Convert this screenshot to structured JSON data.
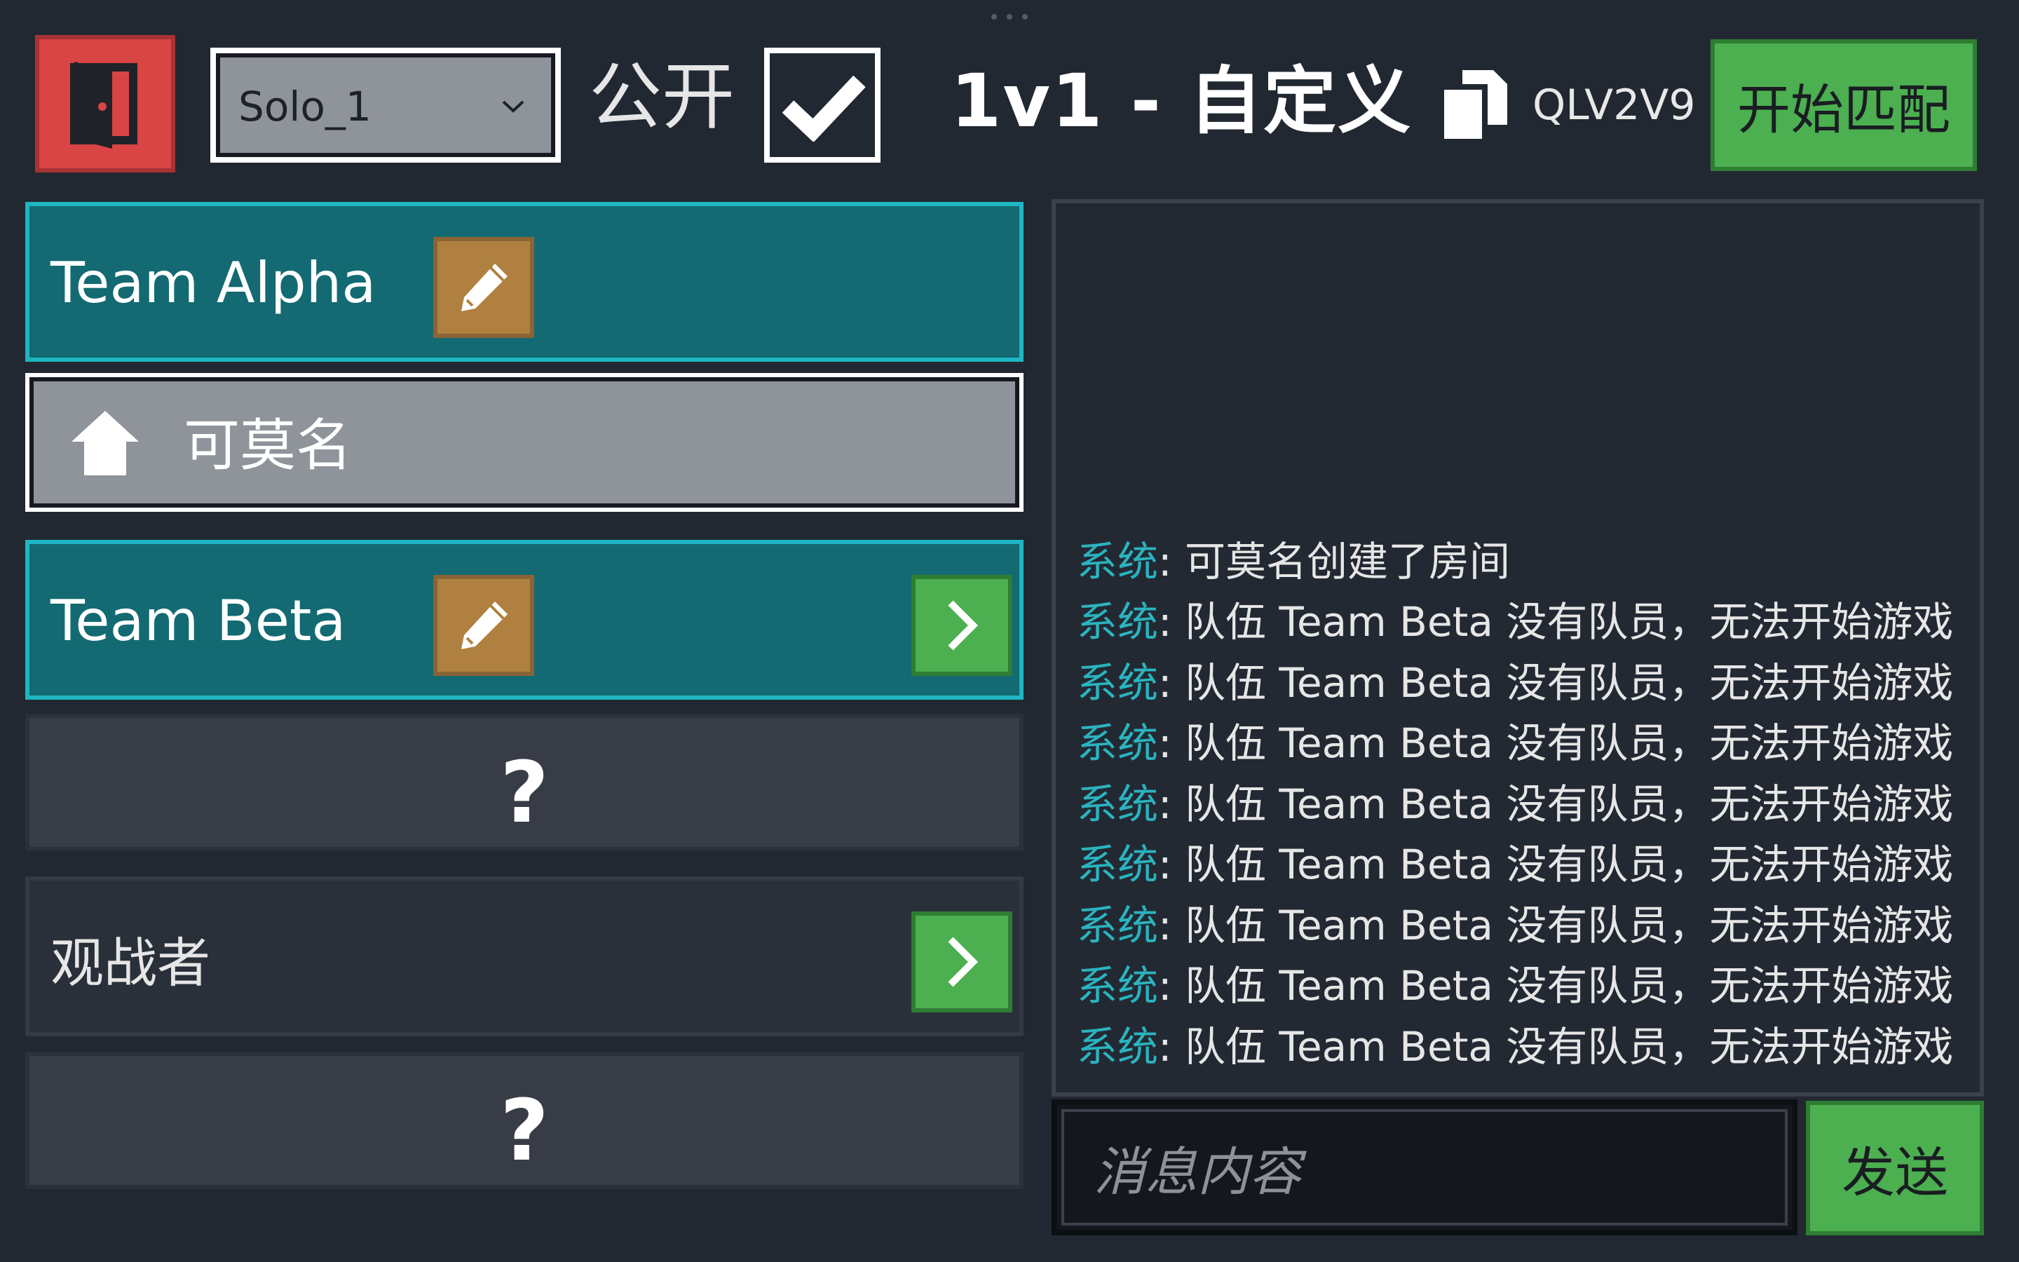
{
  "toolbar": {
    "mode_select": "Solo_1",
    "public_label": "公开",
    "public_checked": true,
    "room_title": "1v1 - 自定义",
    "room_code": "QLV2V9",
    "start_label": "开始匹配"
  },
  "teams": [
    {
      "name": "Team Alpha",
      "players": [
        "可莫名"
      ]
    },
    {
      "name": "Team Beta",
      "players": []
    }
  ],
  "empty_slot_symbol": "?",
  "spectators": {
    "label": "观战者"
  },
  "chat": {
    "messages": [
      {
        "sender": "系统",
        "text": ": 可莫名创建了房间"
      },
      {
        "sender": "系统",
        "text": ": 队伍 Team Beta 没有队员，无法开始游戏"
      },
      {
        "sender": "系统",
        "text": ": 队伍 Team Beta 没有队员，无法开始游戏"
      },
      {
        "sender": "系统",
        "text": ": 队伍 Team Beta 没有队员，无法开始游戏"
      },
      {
        "sender": "系统",
        "text": ": 队伍 Team Beta 没有队员，无法开始游戏"
      },
      {
        "sender": "系统",
        "text": ": 队伍 Team Beta 没有队员，无法开始游戏"
      },
      {
        "sender": "系统",
        "text": ": 队伍 Team Beta 没有队员，无法开始游戏"
      },
      {
        "sender": "系统",
        "text": ": 队伍 Team Beta 没有队员，无法开始游戏"
      },
      {
        "sender": "系统",
        "text": ": 队伍 Team Beta 没有队员，无法开始游戏"
      }
    ],
    "input_placeholder": "消息内容",
    "send_label": "发送"
  },
  "icons": {
    "exit": "door-exit-icon",
    "dropdown": "chevron-down-icon",
    "checkbox": "checkmark-icon",
    "copy": "copy-icon",
    "edit": "pencil-icon",
    "join": "chevron-right-icon",
    "host": "home-icon"
  },
  "colors": {
    "background": "#222831",
    "exit_red": "#d94444",
    "team_teal": "#136a72",
    "team_border": "#1fb5c2",
    "action_green": "#4caf50",
    "edit_gold": "#b08040",
    "system_sender": "#2ab4bf"
  }
}
